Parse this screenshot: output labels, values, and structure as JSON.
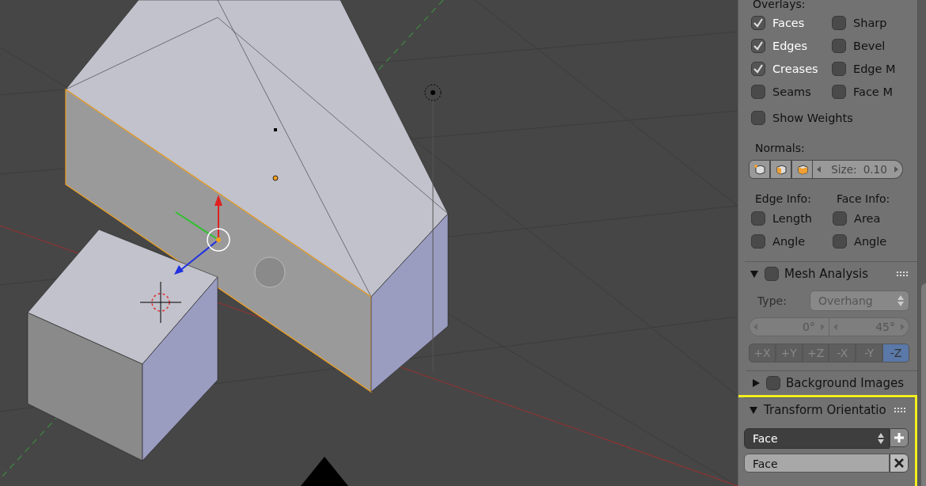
{
  "overlays": {
    "label": "Overlays:",
    "options": [
      {
        "label": "Faces",
        "checked": true
      },
      {
        "label": "Sharp",
        "checked": false
      },
      {
        "label": "Edges",
        "checked": true
      },
      {
        "label": "Bevel",
        "checked": false
      },
      {
        "label": "Creases",
        "checked": true
      },
      {
        "label": "Edge M",
        "checked": false
      },
      {
        "label": "Seams",
        "checked": false
      },
      {
        "label": "Face M",
        "checked": false
      }
    ],
    "show_weights": {
      "label": "Show Weights",
      "checked": false
    }
  },
  "normals": {
    "label": "Normals:",
    "size_label": "Size:",
    "size_value": "0.10"
  },
  "edge_info": {
    "label": "Edge Info:",
    "options": [
      {
        "label": "Length",
        "checked": false
      },
      {
        "label": "Angle",
        "checked": false
      }
    ]
  },
  "face_info": {
    "label": "Face Info:",
    "options": [
      {
        "label": "Area",
        "checked": false
      },
      {
        "label": "Angle",
        "checked": false
      }
    ]
  },
  "mesh_analysis": {
    "title": "Mesh Analysis",
    "expanded": true,
    "enabled": false,
    "type_label": "Type:",
    "type_value": "Overhang",
    "range": [
      "0°",
      "45°"
    ],
    "axes": [
      {
        "label": "+X",
        "selected": false
      },
      {
        "label": "+Y",
        "selected": false
      },
      {
        "label": "+Z",
        "selected": false
      },
      {
        "label": "-X",
        "selected": false
      },
      {
        "label": "-Y",
        "selected": false
      },
      {
        "label": "-Z",
        "selected": true
      }
    ]
  },
  "background_images": {
    "title": "Background Images",
    "expanded": false,
    "enabled": false
  },
  "transform_orientations": {
    "title": "Transform Orientatio",
    "expanded": true,
    "highlighted": true,
    "orientation": "Face",
    "name": "Face"
  }
}
